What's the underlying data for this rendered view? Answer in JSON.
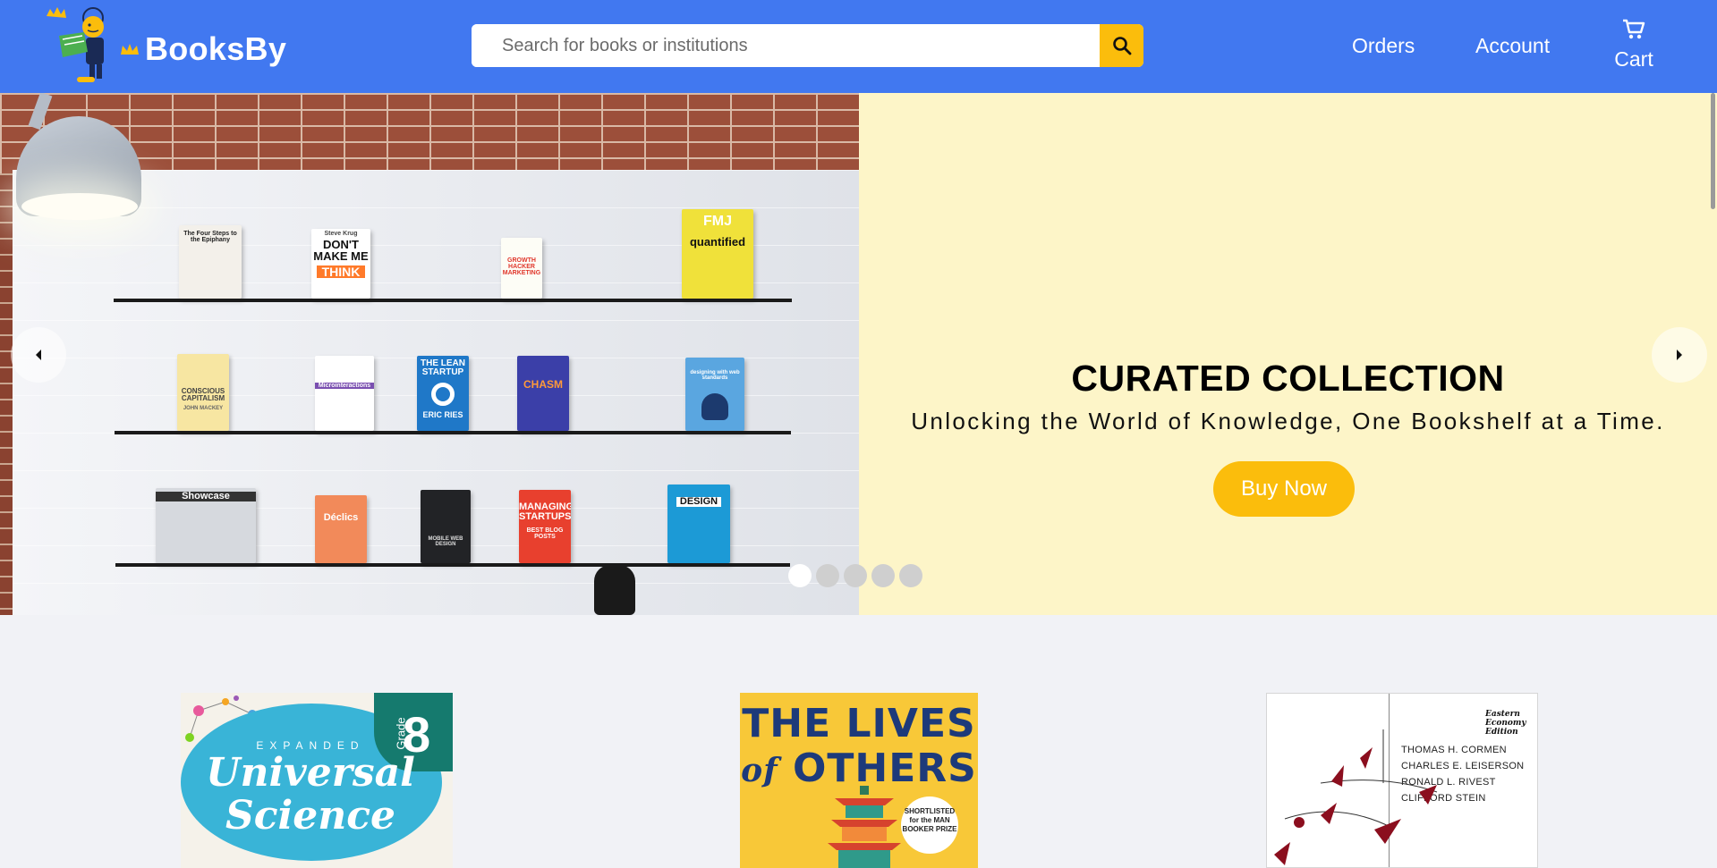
{
  "header": {
    "brand": "BooksBy",
    "search_placeholder": "Search for books or institutions",
    "nav": {
      "orders": "Orders",
      "account": "Account",
      "cart": "Cart"
    }
  },
  "hero": {
    "title": "CURATED COLLECTION",
    "subtitle": "Unlocking the World of Knowledge, One Bookshelf at a Time.",
    "cta": "Buy Now",
    "slide_count": 5,
    "active_slide": 1,
    "shelf_books": {
      "b1": "The Four Steps to the Epiphany",
      "b2a": "Steve Krug",
      "b2b": "DON'T MAKE ME",
      "b2c": "THINK",
      "b3": "GROWTH HACKER MARKETING",
      "b4a": "FMJ",
      "b4b": "quantified",
      "b5a": "CONSCIOUS CAPITALISM",
      "b5b": "JOHN MACKEY",
      "b6": "Microinteractions",
      "b7a": "THE LEAN STARTUP",
      "b7b": "ERIC RIES",
      "b8": "CHASM",
      "b9": "designing with web standards",
      "b10": "Showcase",
      "b11": "Déclics",
      "b12": "MOBILE WEB DESIGN",
      "b13a": "MANAGING STARTUPS",
      "b13b": "BEST BLOG POSTS",
      "b14": "DESIGN"
    }
  },
  "books": [
    {
      "grade_label": "Grade",
      "grade": "8",
      "series": "EXPANDED",
      "title_line1": "Universal",
      "title_line2": "Science"
    },
    {
      "title_line1": "THE LIVES",
      "title_of": "of",
      "title_line2": "OTHERS",
      "badge": "SHORTLISTED for the MAN BOOKER PRIZE"
    },
    {
      "edition": "Eastern Economy Edition",
      "authors": [
        "THOMAS H. CORMEN",
        "CHARLES E. LEISERSON",
        "RONALD L. RIVEST",
        "CLIFFORD STEIN"
      ]
    }
  ],
  "colors": {
    "header_bg": "#4178f0",
    "accent": "#fbbd0c",
    "hero_bg": "#fdf5c8",
    "page_bg": "#f1f2f6"
  }
}
